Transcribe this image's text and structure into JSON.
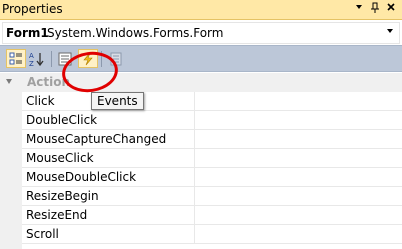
{
  "window": {
    "title": "Properties"
  },
  "object_selector": {
    "name": "Form1",
    "type": "System.Windows.Forms.Form"
  },
  "toolbar": {
    "buttons": [
      {
        "icon": "categorized-icon",
        "active": true
      },
      {
        "icon": "alphabetical-icon",
        "active": false
      },
      {
        "icon": "properties-icon",
        "active": false
      },
      {
        "icon": "events-icon",
        "active": true
      },
      {
        "icon": "property-pages-icon",
        "active": false
      }
    ]
  },
  "tooltip": {
    "text": "Events"
  },
  "grid": {
    "category": "Action",
    "events": [
      {
        "name": "Click",
        "value": ""
      },
      {
        "name": "DoubleClick",
        "value": ""
      },
      {
        "name": "MouseCaptureChanged",
        "value": ""
      },
      {
        "name": "MouseClick",
        "value": ""
      },
      {
        "name": "MouseDoubleClick",
        "value": ""
      },
      {
        "name": "ResizeBegin",
        "value": ""
      },
      {
        "name": "ResizeEnd",
        "value": ""
      },
      {
        "name": "Scroll",
        "value": ""
      }
    ]
  },
  "colors": {
    "titlebar": "#ffe8a6",
    "toolbar": "#bcc7d8",
    "annotation_circle": "#e00000",
    "category_text": "#a0a0a0"
  }
}
